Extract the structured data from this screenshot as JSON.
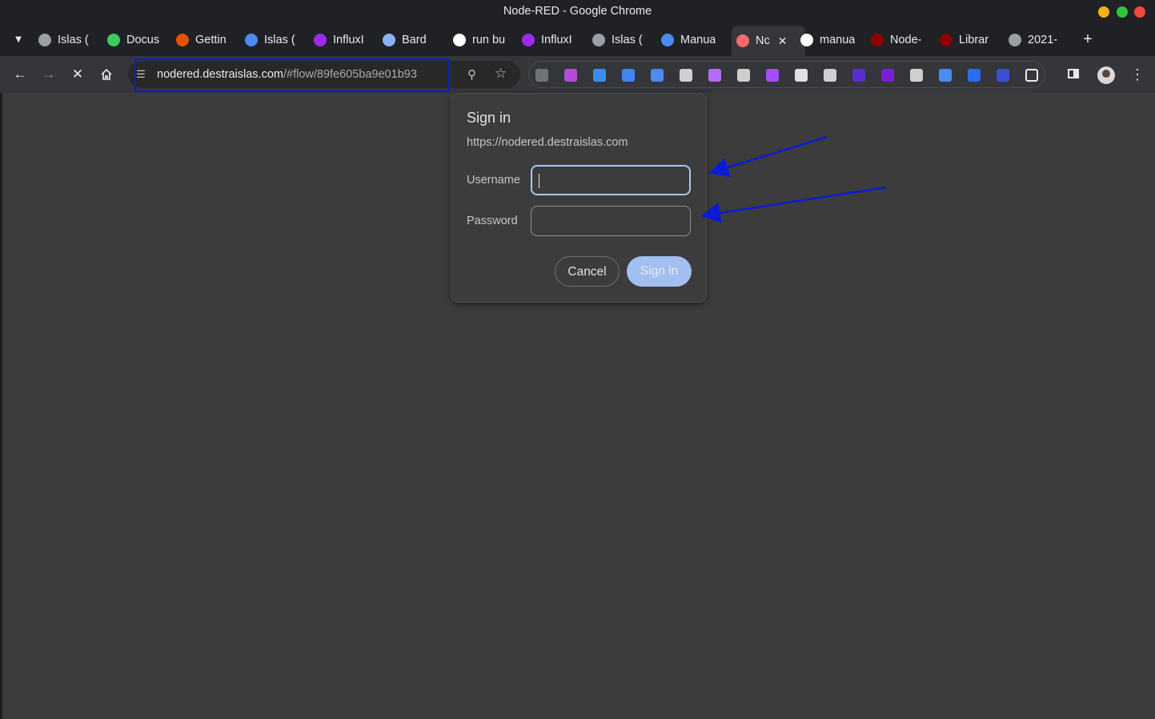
{
  "window": {
    "title": "Node-RED - Google Chrome"
  },
  "tabs": [
    {
      "label": "Islas (",
      "icon": "globe-icon",
      "color": "#9aa0a6"
    },
    {
      "label": "Docus",
      "icon": "docusaurus-icon",
      "color": "#3ecc5f"
    },
    {
      "label": "Gettin",
      "icon": "io-icon",
      "color": "#e65100"
    },
    {
      "label": "Islas (",
      "icon": "globe-icon",
      "color": "#4c8bf5"
    },
    {
      "label": "InfluxI",
      "icon": "influx-icon",
      "color": "#9b2aff"
    },
    {
      "label": "Bard",
      "icon": "sparkle-icon",
      "color": "#8ab4f8"
    },
    {
      "label": "run bu",
      "icon": "github-icon",
      "color": "#ffffff"
    },
    {
      "label": "InfluxI",
      "icon": "influx-icon",
      "color": "#9b2aff"
    },
    {
      "label": "Islas (",
      "icon": "globe-icon",
      "color": "#9aa0a6"
    },
    {
      "label": "Manua",
      "icon": "globe-icon",
      "color": "#4c8bf5"
    },
    {
      "label": "Nc",
      "icon": "loading-icon",
      "color": "#ff6b6b",
      "active": true
    },
    {
      "label": "manua",
      "icon": "google-icon",
      "color": "#ffffff"
    },
    {
      "label": "Node-",
      "icon": "nodered-icon",
      "color": "#8f0000"
    },
    {
      "label": "Librar",
      "icon": "nodered-icon",
      "color": "#8f0000"
    },
    {
      "label": "2021-",
      "icon": "globe-icon",
      "color": "#9aa0a6"
    }
  ],
  "omnibox": {
    "host": "nodered.destraislas.com",
    "path": "/#flow/89fe605ba9e01b93"
  },
  "extensions": [
    "cookie-icon",
    "brackets-icon",
    "circle-icon",
    "translate-icon",
    "wave-icon",
    "image-icon",
    "feather-icon",
    "vue-icon",
    "globe-purple-icon",
    "bulb-icon",
    "react-icon",
    "cube-icon",
    "play-icon",
    "angular-icon",
    "doc-icon",
    "dot-icon",
    "robot-icon",
    "puzzle-icon"
  ],
  "dialog": {
    "title": "Sign in",
    "origin": "https://nodered.destraislas.com",
    "username_label": "Username",
    "password_label": "Password",
    "username_value": "",
    "password_value": "",
    "cancel_label": "Cancel",
    "signin_label": "Sign in"
  },
  "colors": {
    "highlight": "#0a1bd6",
    "signin_button": "#a8c7fa",
    "page_bg": "#3c3c3c"
  }
}
